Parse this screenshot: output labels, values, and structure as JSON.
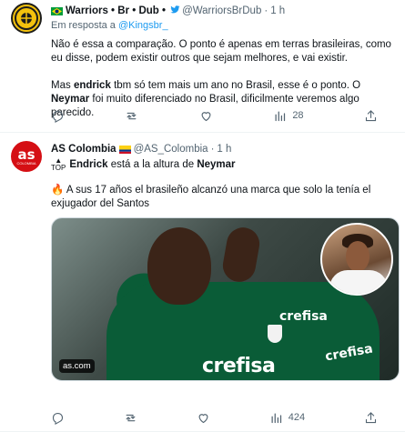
{
  "tweets": [
    {
      "author_name": "Warriors • Br • Dub •",
      "author_handle": "@WarriorsBrDub",
      "time": "1 h",
      "reply_prefix": "Em resposta a",
      "reply_mention": "@Kingsbr_",
      "para1": "Não é essa a comparação. O ponto é apenas em terras brasileiras, como eu disse, podem existir outros que sejam melhores, e vai existir.",
      "para2_a": "Mas",
      "para2_b": "endrick",
      "para2_c": "tbm só tem mais um ano no Brasil, esse é o ponto. O",
      "para2_d": "Neymar",
      "para2_e": "foi muito diferenciado no Brasil, dificilmente veremos algo parecido.",
      "views": "28"
    },
    {
      "author_name": "AS Colombia",
      "author_handle": "@AS_Colombia",
      "time": "1 h",
      "avatar_text": "as",
      "avatar_sub": "COLOMBIA",
      "top_badge": "TOP",
      "headline_a": "Endrick",
      "headline_b": "está a la altura de",
      "headline_c": "Neymar",
      "body": "A sus 17 años el brasileño alcanzó una marca que solo la tenía el exjugador del Santos",
      "media_source": "as.com",
      "sponsor1": "crefisa",
      "sponsor2": "crefisa",
      "sponsor3": "crefisa",
      "views": "424"
    }
  ],
  "icons": {
    "reply": "reply-icon",
    "retweet": "retweet-icon",
    "like": "like-icon",
    "views": "views-icon",
    "share": "share-icon"
  },
  "colors": {
    "link": "#1d9bf0",
    "secondary_text": "#536471",
    "flag_brazil": "#009c3b",
    "flag_colombia": "#fcd116"
  }
}
